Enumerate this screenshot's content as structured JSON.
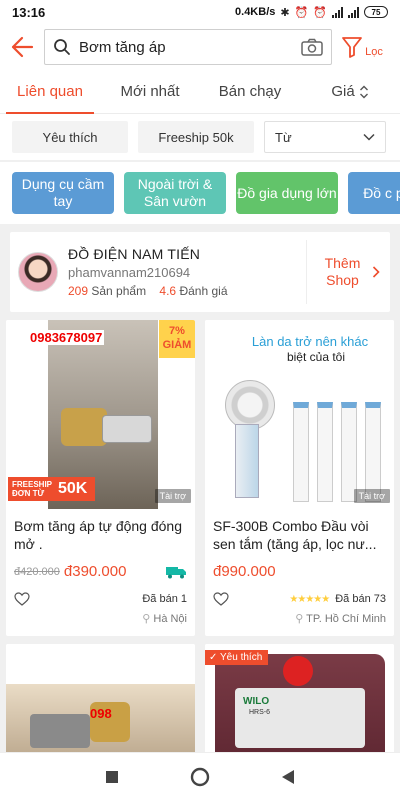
{
  "status_bar": {
    "time": "13:16",
    "net_speed": "0.4KB/s",
    "network": "4G",
    "battery": "75"
  },
  "header": {
    "search_query": "Bơm tăng áp",
    "filter_label": "Lọc"
  },
  "sort_tabs": [
    {
      "label": "Liên quan",
      "active": true
    },
    {
      "label": "Mới nhất",
      "active": false
    },
    {
      "label": "Bán chạy",
      "active": false
    },
    {
      "label": "Giá",
      "active": false
    }
  ],
  "filters": {
    "chips": [
      "Yêu thích",
      "Freeship 50k"
    ],
    "select_value": "Từ"
  },
  "categories": [
    {
      "label": "Dụng cụ cầm tay",
      "color": "#5b9bd5"
    },
    {
      "label": "Ngoài trời & Sân vườn",
      "color": "#5ec6b5"
    },
    {
      "label": "Đồ gia dụng lớn",
      "color": "#62c46a"
    },
    {
      "label": "Đồ c phòng",
      "color": "#5b9bd5"
    }
  ],
  "shop": {
    "name": "ĐỒ ĐIỆN NAM TIẾN",
    "username": "phamvannam210694",
    "products_count": "209",
    "products_label": "Sản phẩm",
    "rating": "4.6",
    "rating_label": "Đánh giá",
    "more_label": "Thêm Shop"
  },
  "products": [
    {
      "title": "Bơm tăng áp tự động đóng mở .",
      "old_price": "đ420.000",
      "price": "đ390.000",
      "sold": "Đã bán 1",
      "location": "Hà Nội",
      "sponsored": "Tài trợ",
      "discount_pct": "7%",
      "discount_word": "GIẢM",
      "phone": "0983678097",
      "freeship_small": "FREESHIP ĐƠN TỪ",
      "freeship_big": "50K"
    },
    {
      "title": "SF-300B Combo  Đầu vòi sen tắm (tăng áp,  lọc nư...",
      "price": "đ990.000",
      "rating_stars": 5,
      "sold": "Đã bán 73",
      "location": "TP. Hồ Chí Minh",
      "sponsored": "Tài trợ",
      "ad_line1": "Làn da trở nên khác",
      "ad_line2": "biệt của tôi"
    },
    {
      "phone_partial": "098"
    },
    {
      "badge": "Yêu thích",
      "brand": "WILO",
      "model": "HRS-6"
    }
  ],
  "colors": {
    "accent": "#ee4d2d",
    "star": "#ffce3d"
  }
}
